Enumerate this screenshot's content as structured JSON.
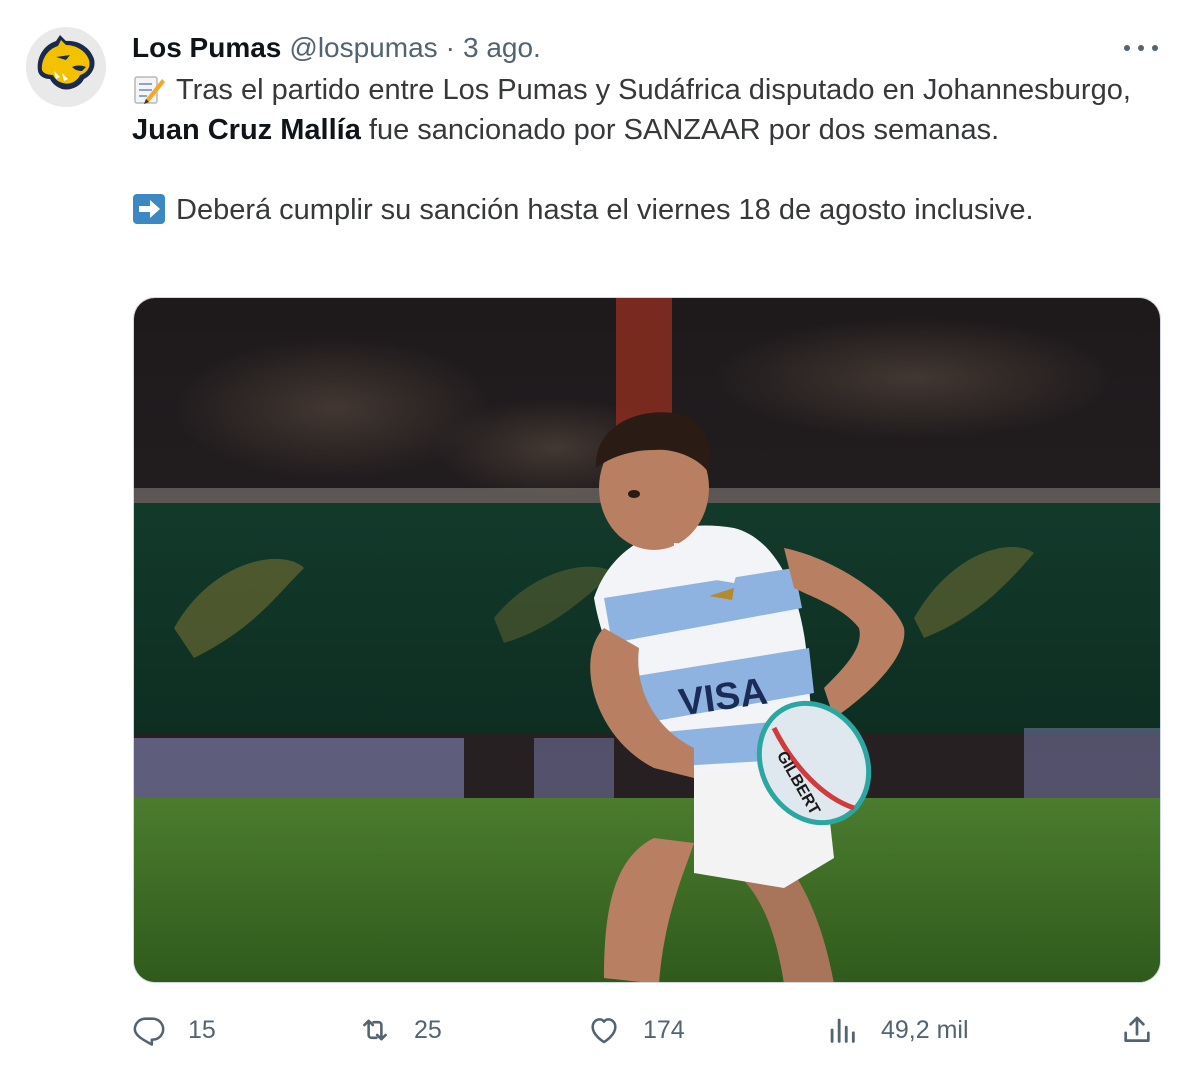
{
  "author": {
    "display_name": "Los Pumas",
    "handle": "@lospumas",
    "separator": "·",
    "time": "3 ago."
  },
  "tweet": {
    "line1_pre": "Tras el partido entre Los Pumas y Sudáfrica disputado en Johannesburgo,",
    "line1_bold": "Juan Cruz Mallía",
    "line1_post": "fue sancionado por SANZAAR por dos semanas.",
    "line2": "Deberá cumplir su sanción hasta el viernes 18 de agosto inclusive.",
    "emoji1": "memo-emoji",
    "emoji2": "right-arrow-emoji"
  },
  "media": {
    "jersey_text": "VISA",
    "ball_text": "GILBERT"
  },
  "actions": {
    "replies": "15",
    "retweets": "25",
    "likes": "174",
    "views": "49,2 mil"
  },
  "colors": {
    "text_primary": "#0f1419",
    "text_secondary": "#536471",
    "avatar_gold": "#f2c200",
    "avatar_navy": "#1b2a4a"
  }
}
